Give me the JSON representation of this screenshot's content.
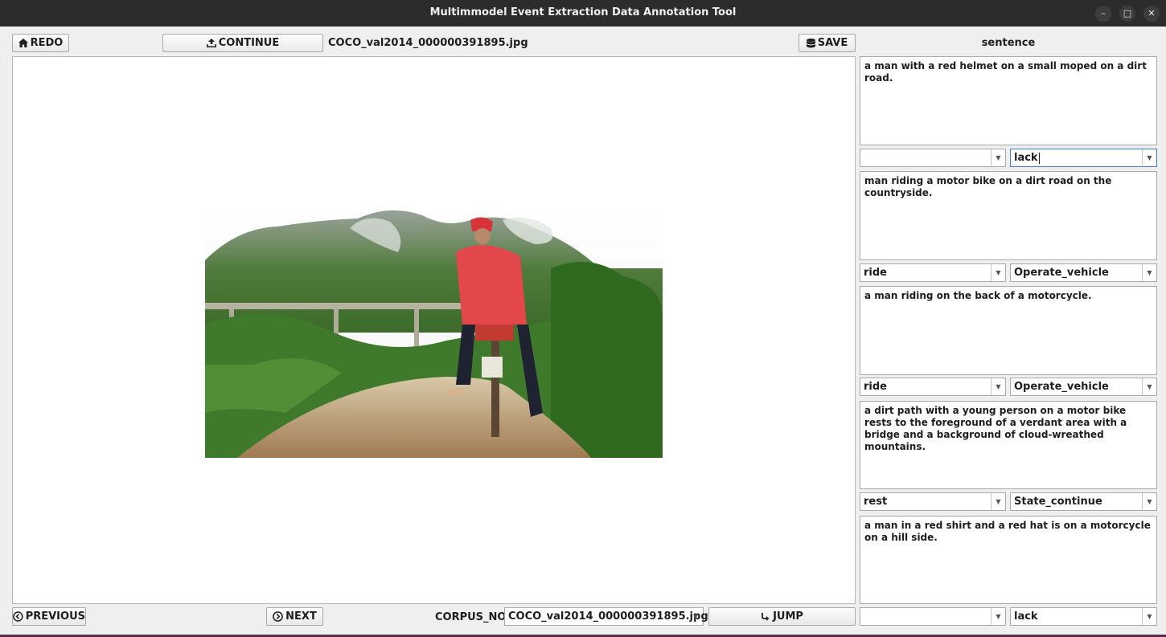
{
  "window": {
    "title": "Multimmodel Event Extraction Data Annotation Tool",
    "controls": {
      "minimize": "–",
      "maximize": "□",
      "close": "✕"
    }
  },
  "toolbar": {
    "redo_label": "REDO",
    "continue_label": "CONTINUE",
    "filename": "COCO_val2014_000000391895.jpg",
    "save_label": "SAVE",
    "sentence_header": "sentence"
  },
  "captions": [
    {
      "text": "a man with a red helmet on a small moped on a dirt road.",
      "trigger": "",
      "event_type": "lack"
    },
    {
      "text": "man riding a motor bike on a dirt road on the countryside.",
      "trigger": "ride",
      "event_type": "Operate_vehicle"
    },
    {
      "text": "a man riding on the back of a motorcycle.",
      "trigger": "ride",
      "event_type": "Operate_vehicle"
    },
    {
      "text": "a dirt path with a young person on a motor bike rests to the foreground of a verdant area with a bridge and a background of cloud-wreathed mountains.",
      "trigger": "rest",
      "event_type": "State_continue"
    },
    {
      "text": "a man in a red shirt and a red hat is on a motorcycle on a hill side.",
      "trigger": "",
      "event_type": "lack"
    }
  ],
  "bottombar": {
    "previous_label": "PREVIOUS",
    "next_label": "NEXT",
    "corpus_label": "CORPUS_NO",
    "corpus_value": "COCO_val2014_000000391895.jpg",
    "jump_label": "JUMP"
  },
  "icons": {
    "home": "home-icon",
    "upload": "upload-icon",
    "database": "database-icon",
    "prev": "chevron-left-circle-icon",
    "next": "chevron-right-circle-icon",
    "jump": "jump-arrow-icon"
  }
}
